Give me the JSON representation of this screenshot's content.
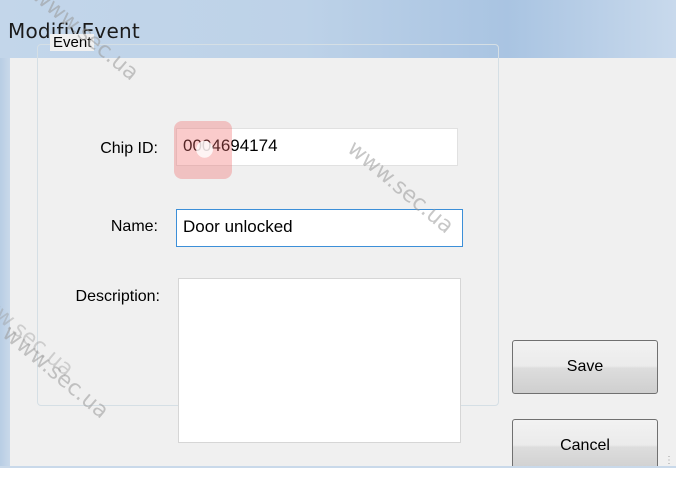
{
  "window": {
    "title": "ModifiyEvent"
  },
  "group": {
    "label": "Event"
  },
  "fields": {
    "chip_id": {
      "label": "Chip ID:",
      "value": "0004694174"
    },
    "name": {
      "label": "Name:",
      "value": "Door unlocked"
    },
    "description": {
      "label": "Description:",
      "value": ""
    }
  },
  "buttons": {
    "save_label": "Save",
    "cancel_label": "Cancel"
  },
  "watermarks": [
    "www.sec.ua",
    "www.sec.ua",
    "www.sec.ua",
    "www.sec.ua"
  ]
}
